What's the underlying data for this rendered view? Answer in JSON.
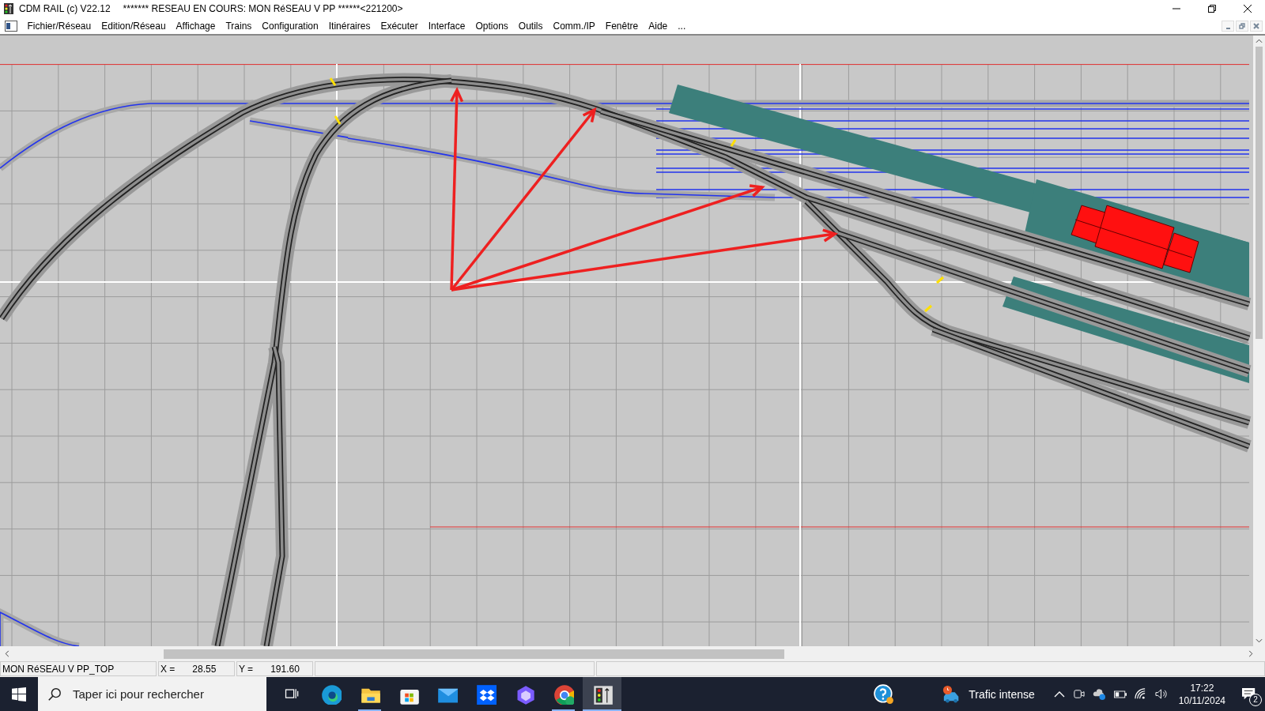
{
  "window": {
    "app_title": "CDM RAIL (c) V22.12",
    "document_title": "******* RESEAU EN COURS: MON RéSEAU V PP ******<221200>"
  },
  "menu": [
    {
      "label": "Fichier/Réseau"
    },
    {
      "label": "Edition/Réseau"
    },
    {
      "label": "Affichage"
    },
    {
      "label": "Trains"
    },
    {
      "label": "Configuration"
    },
    {
      "label": "Itinéraires"
    },
    {
      "label": "Exécuter"
    },
    {
      "label": "Interface"
    },
    {
      "label": "Options"
    },
    {
      "label": "Outils"
    },
    {
      "label": "Comm./IP"
    },
    {
      "label": "Fenêtre"
    },
    {
      "label": "Aide"
    },
    {
      "label": "..."
    }
  ],
  "status_bar": {
    "layer": "MON RéSEAU V PP_TOP",
    "x_label": "X =",
    "x_value": "28.55",
    "y_label": "Y =",
    "y_value": "191.60"
  },
  "taskbar": {
    "search": {
      "placeholder": "Taper ici pour rechercher"
    },
    "apps": [
      {
        "kind": "taskview",
        "running": false,
        "selected": false
      },
      {
        "kind": "edge",
        "running": false,
        "selected": false
      },
      {
        "kind": "explorer",
        "running": true,
        "selected": false
      },
      {
        "kind": "store",
        "running": false,
        "selected": false
      },
      {
        "kind": "mail",
        "running": false,
        "selected": false
      },
      {
        "kind": "dropbox",
        "running": false,
        "selected": false
      },
      {
        "kind": "copilot",
        "running": false,
        "selected": false
      },
      {
        "kind": "chrome",
        "running": true,
        "selected": false
      },
      {
        "kind": "cdmrail",
        "running": true,
        "selected": true
      }
    ],
    "weather": "Trafic intense",
    "time": "17:22",
    "date": "10/11/2024",
    "notifications": "2"
  }
}
